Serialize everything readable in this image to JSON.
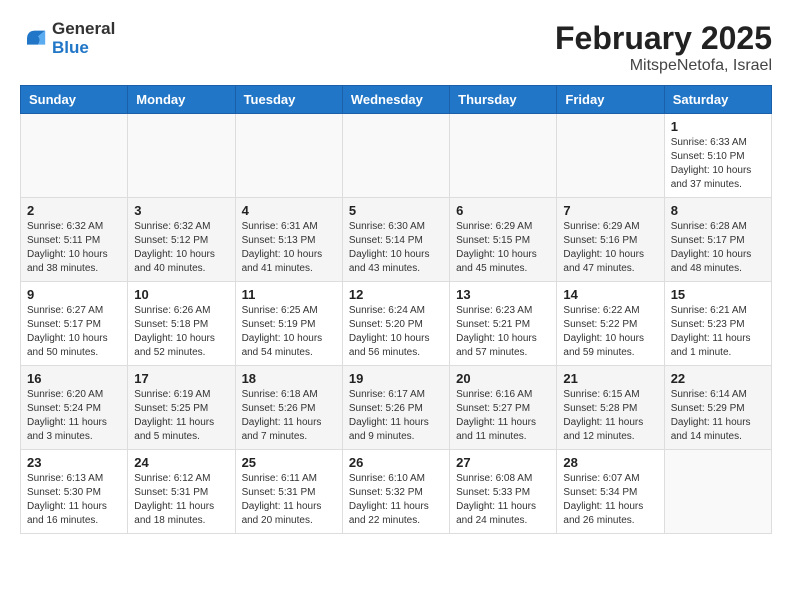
{
  "logo": {
    "general": "General",
    "blue": "Blue"
  },
  "header": {
    "month": "February 2025",
    "location": "MitspeNetofa, Israel"
  },
  "weekdays": [
    "Sunday",
    "Monday",
    "Tuesday",
    "Wednesday",
    "Thursday",
    "Friday",
    "Saturday"
  ],
  "weeks": [
    [
      {
        "day": "",
        "info": ""
      },
      {
        "day": "",
        "info": ""
      },
      {
        "day": "",
        "info": ""
      },
      {
        "day": "",
        "info": ""
      },
      {
        "day": "",
        "info": ""
      },
      {
        "day": "",
        "info": ""
      },
      {
        "day": "1",
        "info": "Sunrise: 6:33 AM\nSunset: 5:10 PM\nDaylight: 10 hours\nand 37 minutes."
      }
    ],
    [
      {
        "day": "2",
        "info": "Sunrise: 6:32 AM\nSunset: 5:11 PM\nDaylight: 10 hours\nand 38 minutes."
      },
      {
        "day": "3",
        "info": "Sunrise: 6:32 AM\nSunset: 5:12 PM\nDaylight: 10 hours\nand 40 minutes."
      },
      {
        "day": "4",
        "info": "Sunrise: 6:31 AM\nSunset: 5:13 PM\nDaylight: 10 hours\nand 41 minutes."
      },
      {
        "day": "5",
        "info": "Sunrise: 6:30 AM\nSunset: 5:14 PM\nDaylight: 10 hours\nand 43 minutes."
      },
      {
        "day": "6",
        "info": "Sunrise: 6:29 AM\nSunset: 5:15 PM\nDaylight: 10 hours\nand 45 minutes."
      },
      {
        "day": "7",
        "info": "Sunrise: 6:29 AM\nSunset: 5:16 PM\nDaylight: 10 hours\nand 47 minutes."
      },
      {
        "day": "8",
        "info": "Sunrise: 6:28 AM\nSunset: 5:17 PM\nDaylight: 10 hours\nand 48 minutes."
      }
    ],
    [
      {
        "day": "9",
        "info": "Sunrise: 6:27 AM\nSunset: 5:17 PM\nDaylight: 10 hours\nand 50 minutes."
      },
      {
        "day": "10",
        "info": "Sunrise: 6:26 AM\nSunset: 5:18 PM\nDaylight: 10 hours\nand 52 minutes."
      },
      {
        "day": "11",
        "info": "Sunrise: 6:25 AM\nSunset: 5:19 PM\nDaylight: 10 hours\nand 54 minutes."
      },
      {
        "day": "12",
        "info": "Sunrise: 6:24 AM\nSunset: 5:20 PM\nDaylight: 10 hours\nand 56 minutes."
      },
      {
        "day": "13",
        "info": "Sunrise: 6:23 AM\nSunset: 5:21 PM\nDaylight: 10 hours\nand 57 minutes."
      },
      {
        "day": "14",
        "info": "Sunrise: 6:22 AM\nSunset: 5:22 PM\nDaylight: 10 hours\nand 59 minutes."
      },
      {
        "day": "15",
        "info": "Sunrise: 6:21 AM\nSunset: 5:23 PM\nDaylight: 11 hours\nand 1 minute."
      }
    ],
    [
      {
        "day": "16",
        "info": "Sunrise: 6:20 AM\nSunset: 5:24 PM\nDaylight: 11 hours\nand 3 minutes."
      },
      {
        "day": "17",
        "info": "Sunrise: 6:19 AM\nSunset: 5:25 PM\nDaylight: 11 hours\nand 5 minutes."
      },
      {
        "day": "18",
        "info": "Sunrise: 6:18 AM\nSunset: 5:26 PM\nDaylight: 11 hours\nand 7 minutes."
      },
      {
        "day": "19",
        "info": "Sunrise: 6:17 AM\nSunset: 5:26 PM\nDaylight: 11 hours\nand 9 minutes."
      },
      {
        "day": "20",
        "info": "Sunrise: 6:16 AM\nSunset: 5:27 PM\nDaylight: 11 hours\nand 11 minutes."
      },
      {
        "day": "21",
        "info": "Sunrise: 6:15 AM\nSunset: 5:28 PM\nDaylight: 11 hours\nand 12 minutes."
      },
      {
        "day": "22",
        "info": "Sunrise: 6:14 AM\nSunset: 5:29 PM\nDaylight: 11 hours\nand 14 minutes."
      }
    ],
    [
      {
        "day": "23",
        "info": "Sunrise: 6:13 AM\nSunset: 5:30 PM\nDaylight: 11 hours\nand 16 minutes."
      },
      {
        "day": "24",
        "info": "Sunrise: 6:12 AM\nSunset: 5:31 PM\nDaylight: 11 hours\nand 18 minutes."
      },
      {
        "day": "25",
        "info": "Sunrise: 6:11 AM\nSunset: 5:31 PM\nDaylight: 11 hours\nand 20 minutes."
      },
      {
        "day": "26",
        "info": "Sunrise: 6:10 AM\nSunset: 5:32 PM\nDaylight: 11 hours\nand 22 minutes."
      },
      {
        "day": "27",
        "info": "Sunrise: 6:08 AM\nSunset: 5:33 PM\nDaylight: 11 hours\nand 24 minutes."
      },
      {
        "day": "28",
        "info": "Sunrise: 6:07 AM\nSunset: 5:34 PM\nDaylight: 11 hours\nand 26 minutes."
      },
      {
        "day": "",
        "info": ""
      }
    ]
  ]
}
